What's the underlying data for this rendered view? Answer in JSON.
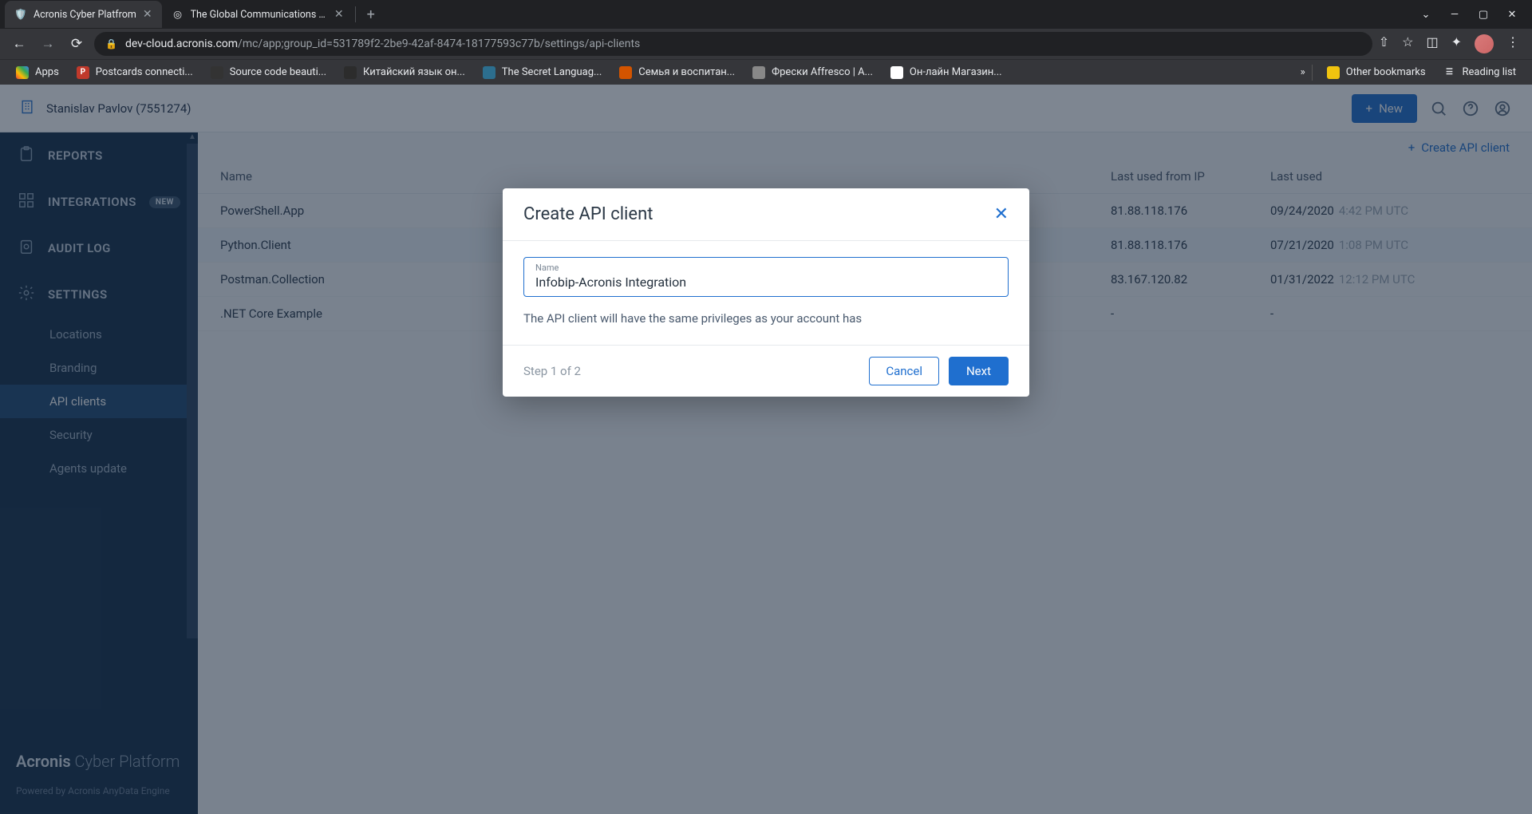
{
  "browser": {
    "tabs": [
      {
        "title": "Acronis Cyber Platfrom",
        "active": true
      },
      {
        "title": "The Global Communications Plat",
        "active": false
      }
    ],
    "url_domain": "dev-cloud.acronis.com",
    "url_path": "/mc/app;group_id=531789f2-2be9-42af-8474-18177593c77b/settings/api-clients",
    "bookmarks": [
      {
        "label": "Apps",
        "color": "none"
      },
      {
        "label": "Postcards connecti...",
        "color": "#c0392b",
        "letter": "P"
      },
      {
        "label": "Source code beauti...",
        "color": "#333",
        "letter": ""
      },
      {
        "label": "Китайский язык он...",
        "color": "#2c2c2c",
        "letter": ""
      },
      {
        "label": "The Secret Languag...",
        "color": "#2c6e8e",
        "letter": ""
      },
      {
        "label": "Семья и воспитан...",
        "color": "#d35400",
        "letter": ""
      },
      {
        "label": "Фрески Affresco | А...",
        "color": "#888",
        "letter": ""
      },
      {
        "label": "Он-лайн Магазин...",
        "color": "#fff",
        "letter": ""
      }
    ],
    "overflow": "»",
    "other_bookmarks": "Other bookmarks",
    "reading_list": "Reading list"
  },
  "topbar": {
    "org": "Stanislav Pavlov (7551274)",
    "new_button": "New"
  },
  "sidebar": {
    "items": [
      {
        "label": "REPORTS"
      },
      {
        "label": "INTEGRATIONS",
        "badge": "NEW"
      },
      {
        "label": "AUDIT LOG"
      },
      {
        "label": "SETTINGS"
      }
    ],
    "subitems": [
      {
        "label": "Locations"
      },
      {
        "label": "Branding"
      },
      {
        "label": "API clients",
        "active": true
      },
      {
        "label": "Security"
      },
      {
        "label": "Agents update"
      }
    ],
    "brand_strong": "Acronis",
    "brand_light": "Cyber Platform",
    "powered": "Powered by Acronis AnyData Engine"
  },
  "main": {
    "create_link": "Create API client",
    "columns": {
      "name": "Name",
      "ip": "Last used from IP",
      "last": "Last used"
    },
    "rows": [
      {
        "name": "PowerShell.App",
        "ip": "81.88.118.176",
        "date": "09/24/2020",
        "time": "4:42 PM UTC"
      },
      {
        "name": "Python.Client",
        "ip": "81.88.118.176",
        "date": "07/21/2020",
        "time": "1:08 PM UTC",
        "active": true
      },
      {
        "name": "Postman.Collection",
        "ip": "83.167.120.82",
        "date": "01/31/2022",
        "time": "12:12 PM UTC"
      },
      {
        "name": ".NET Core Example",
        "ip": "-",
        "date": "-",
        "time": ""
      }
    ]
  },
  "modal": {
    "title": "Create API client",
    "field_label": "Name",
    "field_value": "Infobip-Acronis Integration",
    "hint": "The API client will have the same privileges as your account has",
    "step": "Step 1 of 2",
    "cancel": "Cancel",
    "next": "Next"
  }
}
